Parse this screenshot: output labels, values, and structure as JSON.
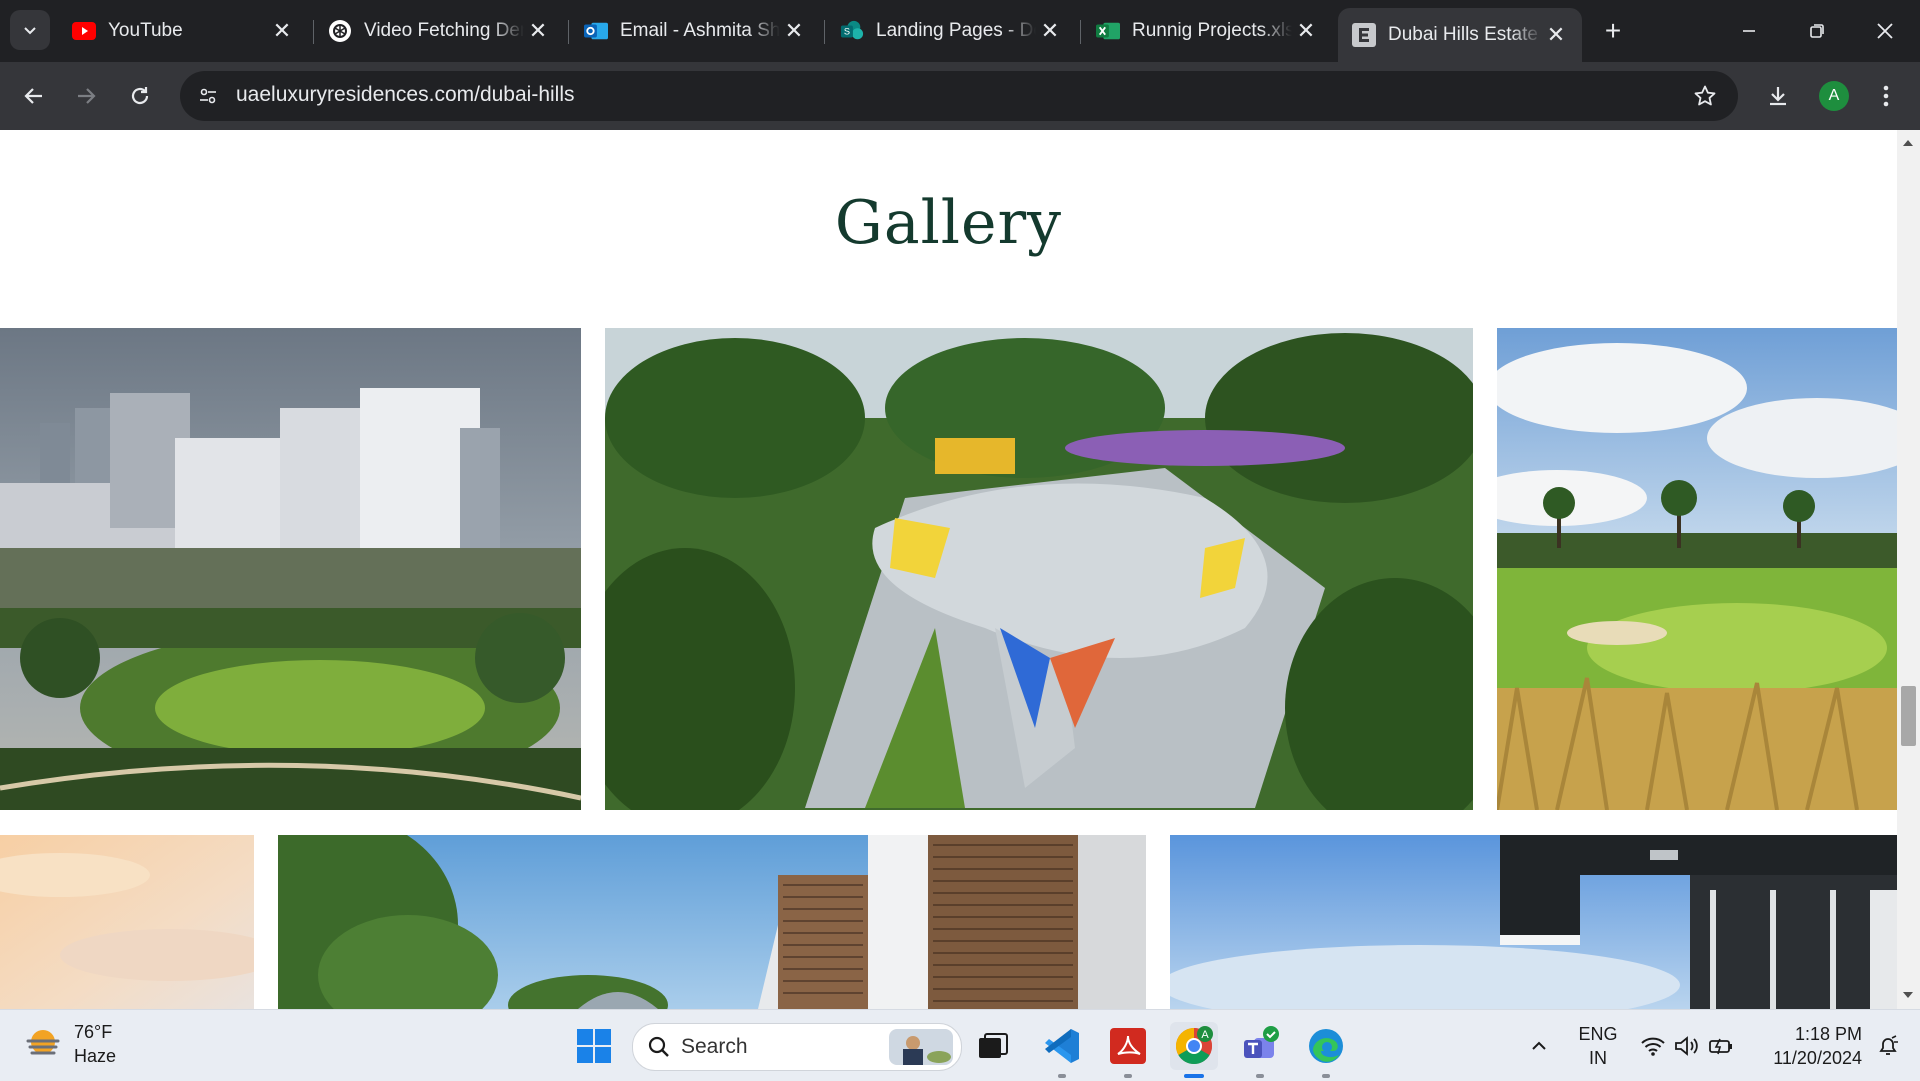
{
  "browser": {
    "tabs": [
      {
        "title": "YouTube",
        "icon": "youtube-icon",
        "active": false
      },
      {
        "title": "Video Fetching Demo",
        "icon": "chatgpt-icon",
        "active": false
      },
      {
        "title": "Email - Ashmita Sharma",
        "icon": "outlook-icon",
        "active": false
      },
      {
        "title": "Landing Pages - Documents",
        "icon": "sharepoint-icon",
        "active": false
      },
      {
        "title": "Runnig Projects.xlsx",
        "icon": "excel-icon",
        "active": false
      },
      {
        "title": "Dubai Hills Estate",
        "icon": "elementor-icon",
        "active": true
      }
    ],
    "close_glyph": "✕",
    "new_tab_glyph": "+",
    "url": "uaeluxuryresidences.com/dubai-hills",
    "profile_initial": "A"
  },
  "page": {
    "gallery_title": "Gallery",
    "photos": [
      {
        "name": "photo-residential-towers-park",
        "subject": "Residential towers with park at dusk"
      },
      {
        "name": "photo-skate-park",
        "subject": "Skate park with palms and crowd"
      },
      {
        "name": "photo-golf-course",
        "subject": "Golf course with palm trees"
      },
      {
        "name": "photo-sunset-sky",
        "subject": "Warm sunset sky"
      },
      {
        "name": "photo-modern-villa-facade",
        "subject": "Modern villa facade with wood slats"
      },
      {
        "name": "photo-villa-overhang",
        "subject": "Villa roof overhang and blue sky"
      }
    ]
  },
  "taskbar": {
    "weather": {
      "temp": "76°F",
      "condition": "Haze"
    },
    "search_label": "Search",
    "language": {
      "line1": "ENG",
      "line2": "IN"
    },
    "time": "1:18 PM",
    "date": "11/20/2024",
    "chrome_badge": "A"
  },
  "colors": {
    "title_green": "#143a2e",
    "tab_bg": "#202124",
    "toolbar_bg": "#35363a",
    "taskbar_bg": "#e9edf3"
  }
}
